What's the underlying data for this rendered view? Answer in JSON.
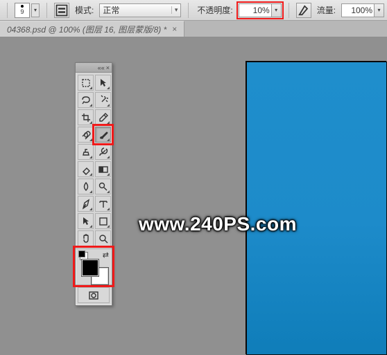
{
  "options_bar": {
    "brush_size": "9",
    "mode_label": "模式:",
    "mode_value": "正常",
    "opacity_label": "不透明度:",
    "opacity_value": "10%",
    "flow_label": "流量:",
    "flow_value": "100%"
  },
  "tab": {
    "title": "04368.psd @ 100% (图层 16, 图层蒙版/8) *",
    "close": "×"
  },
  "watermark": "www.240PS.com",
  "colors": {
    "foreground": "#000000",
    "background": "#ffffff",
    "canvas_doc": "#1d8bca",
    "highlight": "#f01a1a"
  },
  "tools": [
    "move-tool",
    "marquee-tool",
    "lasso-tool",
    "magic-wand-tool",
    "crop-tool",
    "eyedropper-tool",
    "healing-brush-tool",
    "brush-tool",
    "clone-stamp-tool",
    "history-brush-tool",
    "eraser-tool",
    "gradient-tool",
    "blur-tool",
    "dodge-tool",
    "pen-tool",
    "type-tool",
    "path-select-tool",
    "shape-tool",
    "hand-tool",
    "zoom-tool"
  ]
}
